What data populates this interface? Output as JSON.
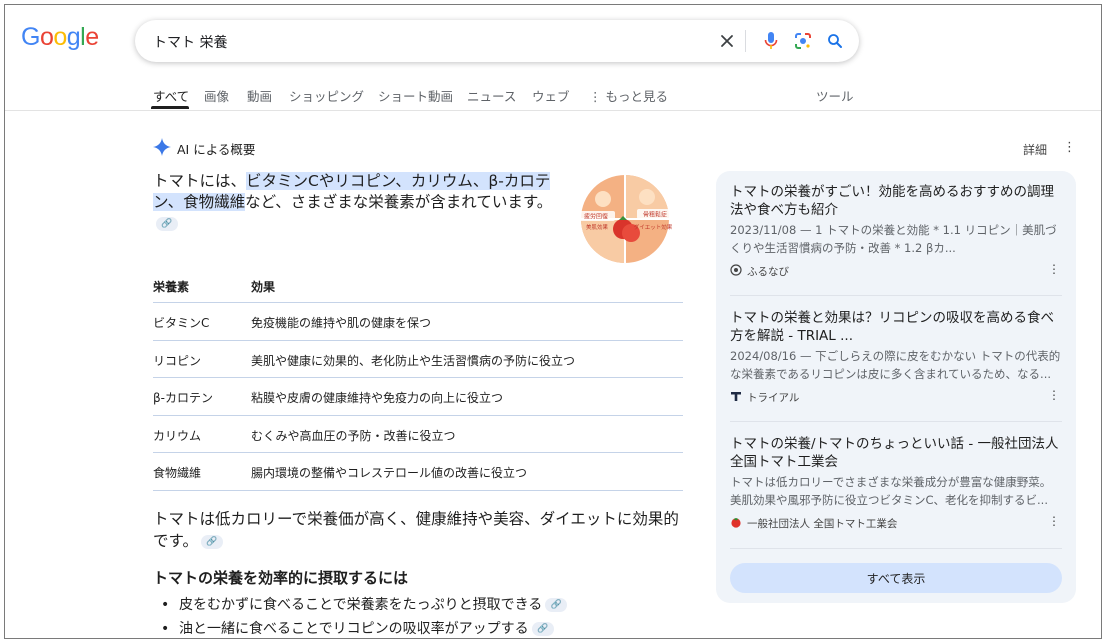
{
  "logo": {
    "text": "Google",
    "letters": [
      "G",
      "o",
      "o",
      "g",
      "l",
      "e"
    ],
    "colors": [
      "#4285F4",
      "#EA4335",
      "#FBBC05",
      "#4285F4",
      "#34A853",
      "#EA4335"
    ]
  },
  "search": {
    "query": "トマト 栄養"
  },
  "tabs": [
    "すべて",
    "画像",
    "動画",
    "ショッピング",
    "ショート動画",
    "ニュース",
    "ウェブ",
    "⋮ もっと見る"
  ],
  "tools_label": "ツール",
  "ai": {
    "title": "AI による概要",
    "detail": "詳細",
    "intro_pre": "トマトには、",
    "intro_highlight": "ビタミンCやリコピン、カリウム、β-カロテン、食物繊維",
    "intro_post": "など、さまざまな栄養素が含まれています。",
    "image_labels": [
      "疲労回復",
      "骨粗鬆症",
      "美肌効果",
      "ダイエット効果"
    ],
    "table": {
      "headers": [
        "栄養素",
        "効果"
      ],
      "rows": [
        [
          "ビタミンC",
          "免疫機能の維持や肌の健康を保つ"
        ],
        [
          "リコピン",
          "美肌や健康に効果的、老化防止や生活習慣病の予防に役立つ"
        ],
        [
          "β-カロテン",
          "粘膜や皮膚の健康維持や免疫力の向上に役立つ"
        ],
        [
          "カリウム",
          "むくみや高血圧の予防・改善に役立つ"
        ],
        [
          "食物繊維",
          "腸内環境の整備やコレステロール値の改善に役立つ"
        ]
      ]
    },
    "summary": "トマトは低カロリーで栄養価が高く、健康維持や美容、ダイエットに効果的です。",
    "subheading": "トマトの栄養を効率的に摂取するには",
    "bullets": [
      "皮をむかずに食べることで栄養素をたっぷりと摂取できる",
      "油と一緒に食べることでリコピンの吸収率がアップする"
    ]
  },
  "sources": [
    {
      "title": "トマトの栄養がすごい！効能を高めるおすすめの調理法や食べ方も紹介",
      "snippet": "2023/11/08 — 1 トマトの栄養と効能 * 1.1 リコピン｜美肌づくりや生活習慣病の予防・改善 * 1.2 βカ...",
      "source": "ふるなび"
    },
    {
      "title": "トマトの栄養と効果は？リコピンの吸収を高める食べ方を解説 - TRIAL ...",
      "snippet": "2024/08/16 — 下ごしらえの際に皮をむかない トマトの代表的な栄養素であるリコピンは皮に多く含まれているため、なる...",
      "source": "トライアル"
    },
    {
      "title": "トマトの栄養/トマトのちょっといい話 - 一般社団法人全国トマト工業会",
      "snippet": "トマトは低カロリーでさまざまな栄養成分が豊富な健康野菜。美肌効果や風邪予防に役立つビタミンC、老化を抑制するビ...",
      "source": "一般社団法人 全国トマト工業会"
    }
  ],
  "show_all": "すべて表示",
  "colors": {
    "accent_blue": "#1a73e8",
    "highlight": "#d3e3fd",
    "panel_bg": "#f0f4f9"
  }
}
